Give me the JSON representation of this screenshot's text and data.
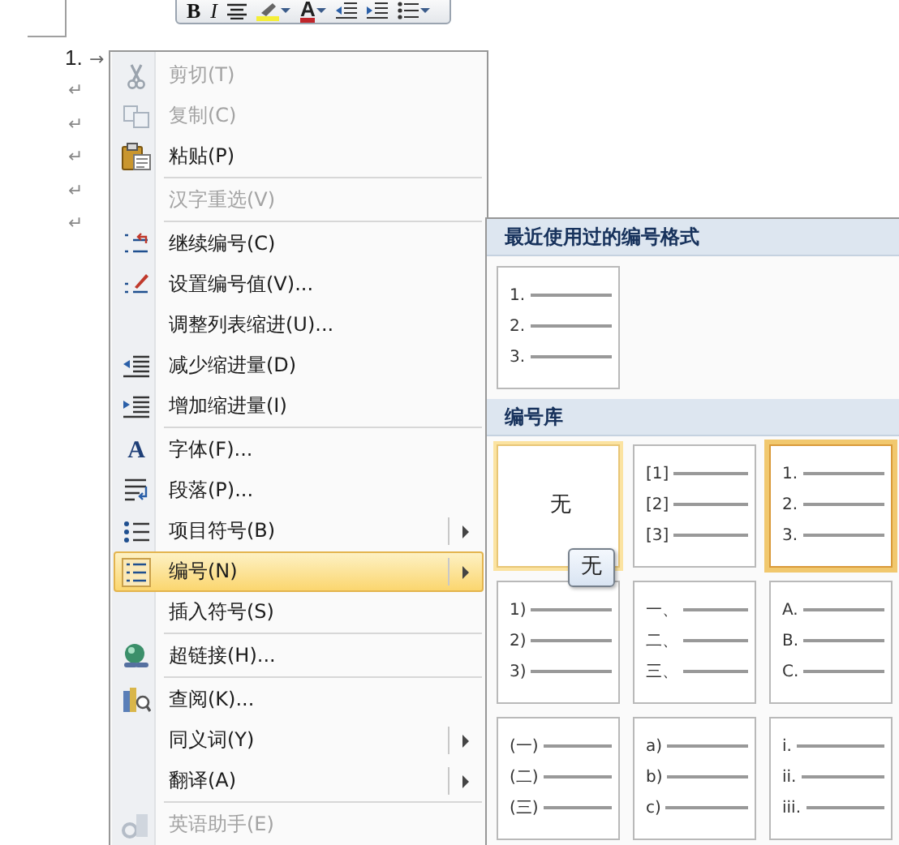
{
  "toolbar": {
    "buttons": [
      {
        "kind": "text",
        "label": "B"
      },
      {
        "kind": "text",
        "label": "I"
      },
      {
        "kind": "icon"
      },
      {
        "kind": "icon",
        "dropdown": true
      },
      {
        "kind": "color-text",
        "label": "A",
        "dropdown": true
      },
      {
        "kind": "icon"
      },
      {
        "kind": "icon"
      },
      {
        "kind": "icon",
        "dropdown": true
      }
    ]
  },
  "document": {
    "list_number": "1.",
    "tab_mark": "→",
    "paragraph_marks": [
      "↵",
      "↵",
      "↵",
      "↵",
      "↵"
    ]
  },
  "context_menu": {
    "items": [
      {
        "label": "剪切(T)",
        "disabled": true,
        "separator_above": false,
        "submenu": false,
        "selected": false
      },
      {
        "label": "复制(C)",
        "disabled": true,
        "separator_above": false,
        "submenu": false,
        "selected": false
      },
      {
        "label": "粘贴(P)",
        "disabled": false,
        "separator_above": false,
        "submenu": false,
        "selected": false
      },
      {
        "label": "汉字重选(V)",
        "disabled": true,
        "separator_above": true,
        "submenu": false,
        "selected": false
      },
      {
        "label": "继续编号(C)",
        "disabled": false,
        "separator_above": true,
        "submenu": false,
        "selected": false
      },
      {
        "label": "设置编号值(V)...",
        "disabled": false,
        "separator_above": false,
        "submenu": false,
        "selected": false
      },
      {
        "label": "调整列表缩进(U)...",
        "disabled": false,
        "separator_above": false,
        "submenu": false,
        "selected": false
      },
      {
        "label": "减少缩进量(D)",
        "disabled": false,
        "separator_above": false,
        "submenu": false,
        "selected": false
      },
      {
        "label": "增加缩进量(I)",
        "disabled": false,
        "separator_above": false,
        "submenu": false,
        "selected": false
      },
      {
        "label": "字体(F)...",
        "icon_text": "A",
        "disabled": false,
        "separator_above": true,
        "submenu": false,
        "selected": false
      },
      {
        "label": "段落(P)...",
        "disabled": false,
        "separator_above": false,
        "submenu": false,
        "selected": false
      },
      {
        "label": "项目符号(B)",
        "disabled": false,
        "separator_above": false,
        "submenu": true,
        "selected": false
      },
      {
        "label": "编号(N)",
        "disabled": false,
        "separator_above": false,
        "submenu": true,
        "selected": true
      },
      {
        "label": "插入符号(S)",
        "disabled": false,
        "separator_above": false,
        "submenu": false,
        "selected": false
      },
      {
        "label": "超链接(H)...",
        "disabled": false,
        "separator_above": true,
        "submenu": false,
        "selected": false
      },
      {
        "label": "查阅(K)...",
        "disabled": false,
        "separator_above": true,
        "submenu": false,
        "selected": false
      },
      {
        "label": "同义词(Y)",
        "disabled": false,
        "separator_above": false,
        "submenu": true,
        "selected": false
      },
      {
        "label": "翻译(A)",
        "disabled": false,
        "separator_above": false,
        "submenu": true,
        "selected": false
      },
      {
        "label": "英语助手(E)",
        "disabled": true,
        "separator_above": true,
        "submenu": false,
        "selected": false
      }
    ]
  },
  "numbering_menu": {
    "recent": {
      "title": "最近使用过的编号格式",
      "items": [
        {
          "kind": "list",
          "markers": [
            "1.",
            "2.",
            "3."
          ],
          "selected": false,
          "hovered": false
        }
      ]
    },
    "library": {
      "title": "编号库",
      "items": [
        {
          "kind": "none",
          "label": "无",
          "selected": false,
          "hovered": true
        },
        {
          "kind": "list",
          "markers": [
            "[1]",
            "[2]",
            "[3]"
          ],
          "selected": false,
          "hovered": false
        },
        {
          "kind": "list",
          "markers": [
            "1.",
            "2.",
            "3."
          ],
          "selected": true,
          "hovered": false
        },
        {
          "kind": "list",
          "markers": [
            "1)",
            "2)",
            "3)"
          ],
          "selected": false,
          "hovered": false
        },
        {
          "kind": "list",
          "markers": [
            "一、",
            "二、",
            "三、"
          ],
          "selected": false,
          "hovered": false
        },
        {
          "kind": "list",
          "markers": [
            "A.",
            "B.",
            "C."
          ],
          "selected": false,
          "hovered": false
        },
        {
          "kind": "list",
          "markers": [
            "(一)",
            "(二)",
            "(三)"
          ],
          "selected": false,
          "hovered": false
        },
        {
          "kind": "list",
          "markers": [
            "a)",
            "b)",
            "c)"
          ],
          "selected": false,
          "hovered": false
        },
        {
          "kind": "list",
          "markers": [
            "i.",
            "ii.",
            "iii."
          ],
          "selected": false,
          "hovered": false
        }
      ]
    }
  },
  "tooltip": {
    "text": "无"
  }
}
